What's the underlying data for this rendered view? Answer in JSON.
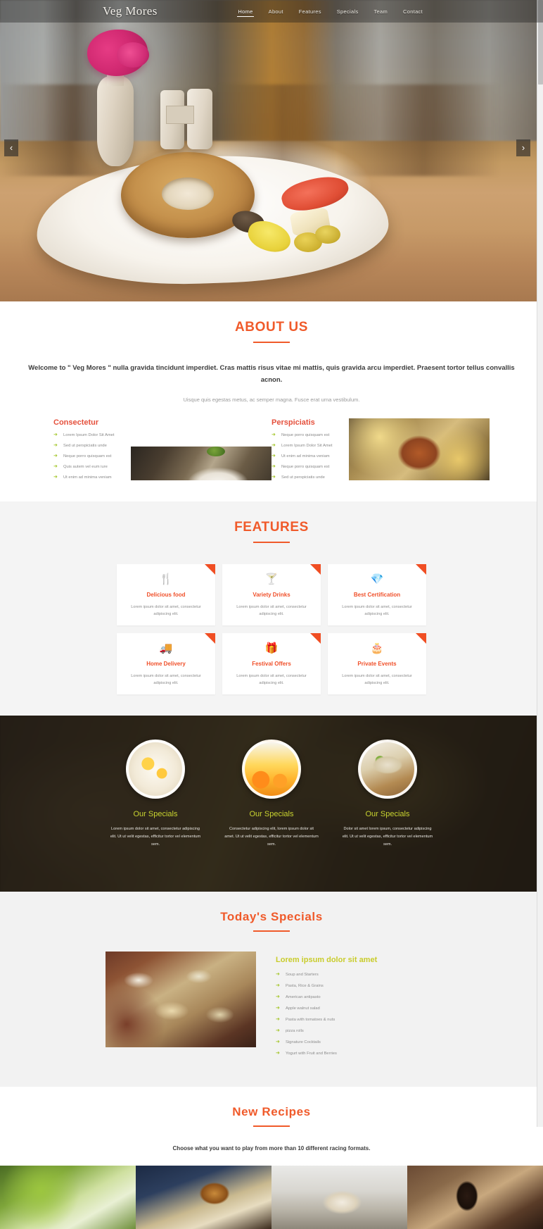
{
  "header": {
    "brand": "Veg Mores",
    "nav": [
      {
        "label": "Home",
        "active": true
      },
      {
        "label": "About",
        "active": false
      },
      {
        "label": "Features",
        "active": false
      },
      {
        "label": "Specials",
        "active": false
      },
      {
        "label": "Team",
        "active": false
      },
      {
        "label": "Contact",
        "active": false
      }
    ]
  },
  "slider": {
    "prev_label": "‹",
    "next_label": "›"
  },
  "about": {
    "title": "ABOUT US",
    "lead": "Welcome to \" Veg Mores \" nulla gravida tincidunt imperdiet. Cras mattis risus vitae mi mattis, quis gravida arcu imperdiet. Praesent tortor tellus convallis acnon.",
    "sub": "Uisque quis egestas metus, ac semper magna. Fusce erat urna vestibulum.",
    "columns": [
      {
        "heading": "Consectetur",
        "items": [
          "Lorem Ipsum Dolor Sit Amet",
          "Sed ut perspiciatis unde",
          "Neque porro quisquam est",
          "Quis autem vel eum iure",
          "Ut enim ad minima veniam"
        ]
      },
      {
        "heading": "Perspiciatis",
        "items": [
          "Neque porro quisquam est",
          "Lorem Ipsum Dolor Sit Amet",
          "Ut enim ad minima veniam",
          "Neque porro quisquam est",
          "Sed ut perspiciatis unde"
        ]
      }
    ]
  },
  "features": {
    "title": "FEATURES",
    "cards": [
      {
        "icon": "🍴",
        "icon_name": "cutlery-icon",
        "title": "Delicious food",
        "text": "Lorem ipsum dolor sit amet, consectetur adipiscing elit."
      },
      {
        "icon": "🍸",
        "icon_name": "cocktail-icon",
        "title": "Variety Drinks",
        "text": "Lorem ipsum dolor sit amet, consectetur adipiscing elit."
      },
      {
        "icon": "💎",
        "icon_name": "diamond-icon",
        "title": "Best Certification",
        "text": "Lorem ipsum dolor sit amet, consectetur adipiscing elit."
      },
      {
        "icon": "🚚",
        "icon_name": "truck-icon",
        "title": "Home Delivery",
        "text": "Lorem ipsum dolor sit amet, consectetur adipiscing elit."
      },
      {
        "icon": "🎁",
        "icon_name": "gift-icon",
        "title": "Festival Offers",
        "text": "Lorem ipsum dolor sit amet, consectetur adipiscing elit."
      },
      {
        "icon": "🎂",
        "icon_name": "cake-icon",
        "title": "Private Events",
        "text": "Lorem ipsum dolor sit amet, consectetur adipiscing elit."
      }
    ]
  },
  "specials": [
    {
      "title": "Our Specials",
      "text": "Lorem ipsum dolor sit amet, consectetur adipiscing elit. Ut ut velit egestas, efficitur tortor vel elementum sem."
    },
    {
      "title": "Our Specials",
      "text": "Consectetur adipiscing elit, lorem ipsum dolor sit amet. Ut ut velit egestas, efficitur tortor vel elementum sem."
    },
    {
      "title": "Our Specials",
      "text": "Dolor sit amet lorem ipsum, consectetur adipiscing elit. Ut ut velit egestas, efficitur tortor vel elementum sem."
    }
  ],
  "today": {
    "title": "Today's Specials",
    "heading": "Lorem ipsum dolor sit amet",
    "items": [
      "Soup and Starters",
      "Pasta, Rice & Grains",
      "American antipasto",
      "Apple walnut salad",
      "Pasta with tomatoes & nuts",
      "pizza rolls",
      "Signature Cocktails",
      "Yogurt with Fruit and Berries"
    ]
  },
  "recipes": {
    "title": "New Recipes",
    "subtitle": "Choose what you want to play from more than 10 different racing formats."
  },
  "colors": {
    "accent": "#f05a2a",
    "green": "#a8cc27",
    "yellow_green": "#c9cc2b",
    "dark": "#2a2116"
  }
}
